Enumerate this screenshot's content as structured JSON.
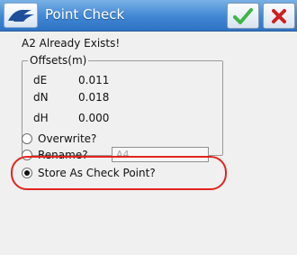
{
  "window": {
    "title": "Point Check",
    "colors": {
      "titlebar": "#3f86d3",
      "ok_check": "#3fb548",
      "close_x": "#cf1f1f",
      "highlight": "#e3241e"
    }
  },
  "message": "A2 Already Exists!",
  "offsets": {
    "title": "Offsets(m)",
    "rows": [
      {
        "label": "dE",
        "value": "0.011"
      },
      {
        "label": "dN",
        "value": "0.018"
      },
      {
        "label": "dH",
        "value": "0.000"
      }
    ]
  },
  "options": {
    "overwrite": "Overwrite?",
    "rename": "Rename?",
    "store": "Store As Check Point?",
    "selected": "store"
  },
  "rename_field": {
    "value": "A4"
  },
  "icons": {
    "app": "trimble-logo-icon",
    "ok": "checkmark-icon",
    "close": "close-icon"
  }
}
